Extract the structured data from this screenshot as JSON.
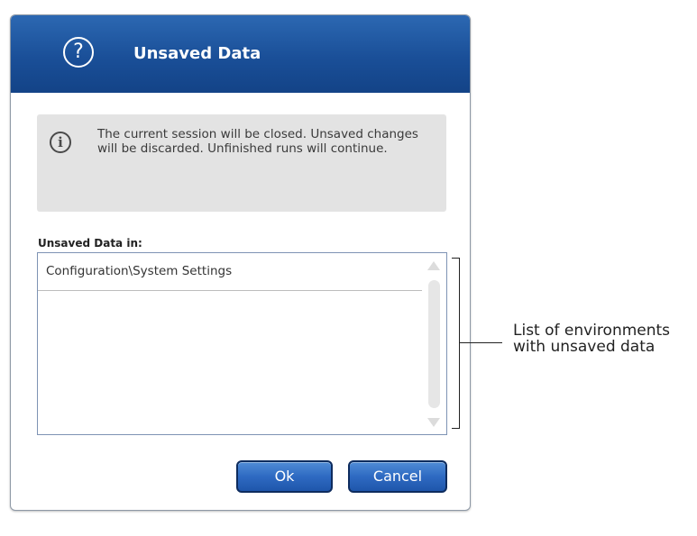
{
  "dialog": {
    "title": "Unsaved Data",
    "title_icon": "question-icon",
    "title_glyph": "?",
    "info": {
      "icon": "info-icon",
      "glyph": "i",
      "message": "The current session will be closed. Unsaved changes will be discarded. Unfinished runs will continue."
    },
    "list": {
      "label": "Unsaved Data in:",
      "items": [
        "Configuration\\System Settings"
      ]
    },
    "buttons": {
      "ok_label": "Ok",
      "cancel_label": "Cancel"
    },
    "colors": {
      "titlebar": "#1a4f98",
      "button": "#2e6ac2",
      "info_background": "#e3e3e3"
    }
  },
  "callout": {
    "line1": "List of environments",
    "line2": "with unsaved data"
  }
}
